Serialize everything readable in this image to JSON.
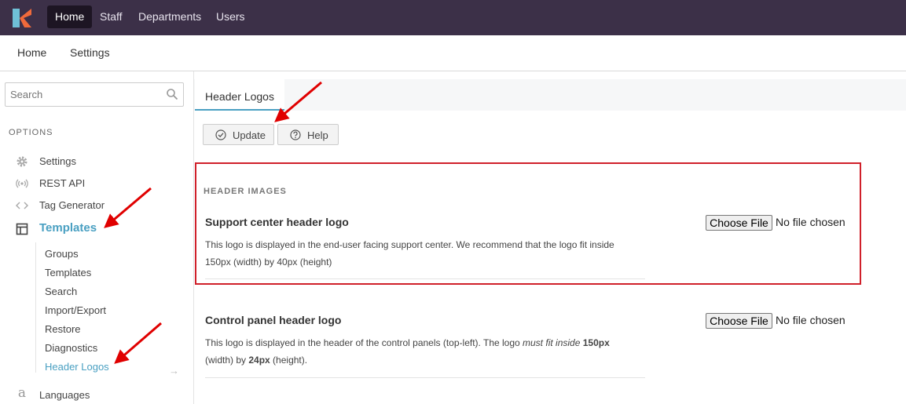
{
  "topnav": {
    "items": [
      {
        "label": "Home",
        "active": true
      },
      {
        "label": "Staff"
      },
      {
        "label": "Departments"
      },
      {
        "label": "Users"
      }
    ]
  },
  "subnav": {
    "items": [
      {
        "label": "Home"
      },
      {
        "label": "Settings"
      }
    ]
  },
  "sidebar": {
    "search_placeholder": "Search",
    "options_label": "OPTIONS",
    "items": [
      {
        "label": "Settings",
        "icon": "gear-icon"
      },
      {
        "label": "REST API",
        "icon": "broadcast-icon"
      },
      {
        "label": "Tag Generator",
        "icon": "code-icon"
      },
      {
        "label": "Templates",
        "icon": "template-icon"
      }
    ],
    "submenu": [
      {
        "label": "Groups"
      },
      {
        "label": "Templates"
      },
      {
        "label": "Search"
      },
      {
        "label": "Import/Export"
      },
      {
        "label": "Restore"
      },
      {
        "label": "Diagnostics"
      },
      {
        "label": "Header Logos",
        "active": true
      }
    ],
    "languages_label": "Languages"
  },
  "main": {
    "tab": "Header Logos",
    "buttons": {
      "update": "Update",
      "help": "Help"
    },
    "section_title": "HEADER IMAGES",
    "fields": [
      {
        "title": "Support center header logo",
        "desc_lines": [
          "This logo is displayed in the end-user facing support center. We recommend that the logo fit inside",
          "150px (width) by 40px (height)"
        ],
        "file_button": "Choose File",
        "file_status": "No file chosen"
      },
      {
        "title": "Control panel header logo",
        "desc": {
          "a": "This logo is displayed in the header of the control panels (top-left). The logo ",
          "b": "must fit inside",
          "c": " ",
          "d": "150px",
          "e": "(width) by ",
          "f": "24px",
          "g": " (height)."
        },
        "file_button": "Choose File",
        "file_status": "No file chosen"
      }
    ]
  },
  "colors": {
    "topnav_bg": "#3c3048",
    "accent": "#4aa0c2",
    "annotation": "#e00000",
    "highlight_border": "#d0202a"
  }
}
